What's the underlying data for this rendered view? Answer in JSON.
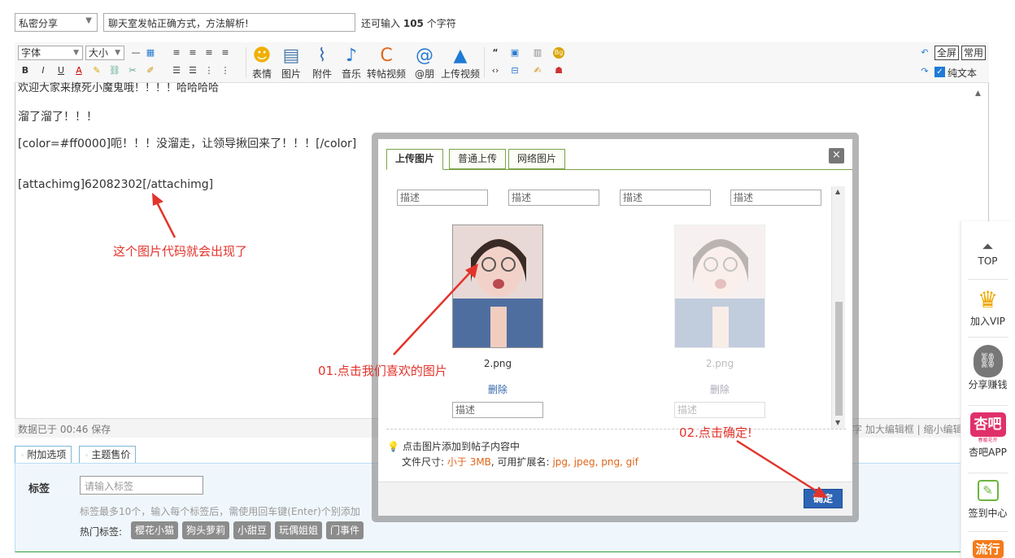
{
  "header": {
    "category_value": "私密分享",
    "title_value": "聊天室发帖正确方式，方法解析!",
    "char_count_prefix": "还可输入",
    "char_count_number": "105",
    "char_count_suffix": "个字符"
  },
  "toolbar": {
    "font_select": "字体",
    "size_select": "大小",
    "emoji_label": "表情",
    "image_label": "图片",
    "attach_label": "附件",
    "music_label": "音乐",
    "repost_video_label": "转帖视频",
    "at_label": "@朋",
    "upload_video_label": "上传视频",
    "fullscreen_label": "全屏",
    "common_label": "常用",
    "plain_text_label": "纯文本"
  },
  "editor": {
    "line1": "欢迎大家来撩死小魔鬼哦！！！！哈哈哈哈",
    "line2": "溜了溜了！！！",
    "line3": "[color=#ff0000]呃！！！没溜走，让领导揪回来了！！！[/color]",
    "line4": "[attachimg]62082302[/attachimg]",
    "status_text": "数据已于 00:46 保存",
    "status_right": "字  加大编辑框 | 缩小编辑"
  },
  "annotations": {
    "code_appears": "这个图片代码就会出现了",
    "step1": "01.点击我们喜欢的图片",
    "step2": "02.点击确定!"
  },
  "options": {
    "tab_attach": "附加选项",
    "tab_price": "主题售价",
    "tag_label": "标签",
    "tag_placeholder": "请输入标签",
    "tag_hint": "标签最多10个，输入每个标签后，需使用回车键(Enter)个别添加",
    "hot_label": "热门标签:",
    "hot_tags": [
      "樱花小猫",
      "狗头萝莉",
      "小甜豆",
      "玩偶姐姐",
      "门事件"
    ]
  },
  "modal": {
    "tabs": [
      "上传图片",
      "普通上传",
      "网络图片"
    ],
    "close_glyph": "×",
    "desc_placeholder": "描述",
    "items": [
      {
        "filename": "2.png",
        "delete": "删除"
      },
      {
        "filename": "2.png",
        "delete": "删除"
      }
    ],
    "tip": "点击图片添加到帖子内容中",
    "filesize_prefix": "文件尺寸:",
    "filesize_limit": "小于 3MB",
    "filesize_mid": ", 可用扩展名:",
    "filesize_ext": "jpg, jpeg, png, gif",
    "confirm_label": "确定"
  },
  "sidebar": {
    "top_label": "TOP",
    "vip_label": "加入VIP",
    "share_label": "分享赚钱",
    "app_logo_text": "杏吧",
    "app_logo_sub": "春暖花开",
    "app_label": "杏吧APP",
    "signin_label": "签到中心",
    "liuxing_label": "流行"
  },
  "colors": {
    "annotation_red": "#e2342c",
    "confirm_blue": "#2d64b3",
    "tab_green": "#7ba34a",
    "app_brand": "#e0306a"
  }
}
